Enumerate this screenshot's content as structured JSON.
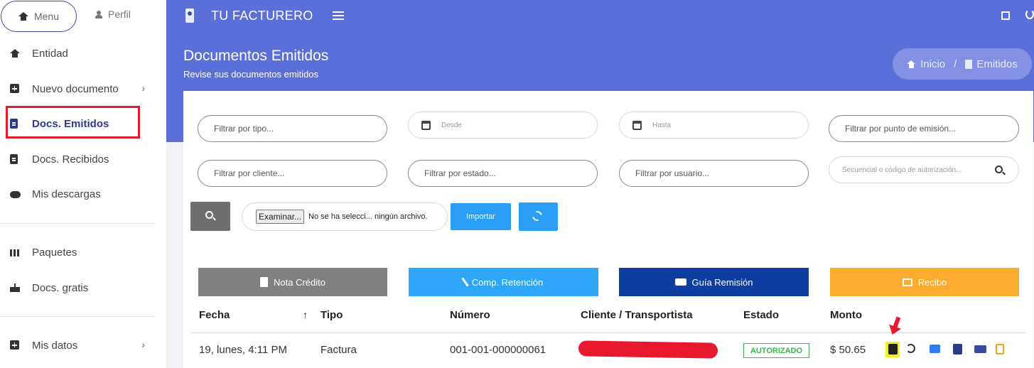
{
  "sidebar": {
    "tab_menu": "Menu",
    "tab_perfil": "Perfil",
    "items": [
      {
        "label": "Entidad"
      },
      {
        "label": "Nuevo documento",
        "chevron": "›"
      },
      {
        "label": "Docs. Emitidos"
      },
      {
        "label": "Docs. Recibidos"
      },
      {
        "label": "Mis descargas"
      },
      {
        "label": "Paquetes"
      },
      {
        "label": "Docs. gratis"
      },
      {
        "label": "Mis datos",
        "chevron": "›"
      }
    ]
  },
  "topbar": {
    "brand": "TU FACTURERO"
  },
  "header": {
    "title": "Documentos Emitidos",
    "subtitle": "Revise sus documentos emitidos",
    "breadcrumb": {
      "home": "Inicio",
      "separator": "/",
      "current": "Emitidos"
    }
  },
  "filters": {
    "tipo": "Filtrar por tipo...",
    "desde": "Desde",
    "hasta": "Hasta",
    "punto": "Filtrar por punto de emisión...",
    "cliente": "Filtrar por cliente...",
    "estado": "Filtrar por estado...",
    "usuario": "Filtrar por usuario...",
    "secuencial": "Secuencial o código de autorización..."
  },
  "file": {
    "button": "Examinar...",
    "status": "No se ha selecci... ningún archivo."
  },
  "import_label": "Importar",
  "actions": {
    "nota": "Nota Crédito",
    "retencion": "Comp. Retención",
    "guia": "Guía Remisión",
    "recibo": "Recibo"
  },
  "colors": {
    "primary": "#5a6fd8",
    "nota": "#808080",
    "retencion": "#2ea7f8",
    "guia": "#0e3fa0",
    "recibo": "#fbac2f",
    "badge": "#3ab54a"
  },
  "table": {
    "headers": {
      "fecha": "Fecha",
      "sort": "↑",
      "tipo": "Tipo",
      "numero": "Número",
      "cliente": "Cliente / Transportista",
      "estado": "Estado",
      "monto": "Monto"
    },
    "rows": [
      {
        "fecha": "19, lunes, 4:11 PM",
        "tipo": "Factura",
        "numero": "001-001-000000061",
        "estado": "AUTORIZADO",
        "monto": "$ 50.65"
      }
    ]
  }
}
